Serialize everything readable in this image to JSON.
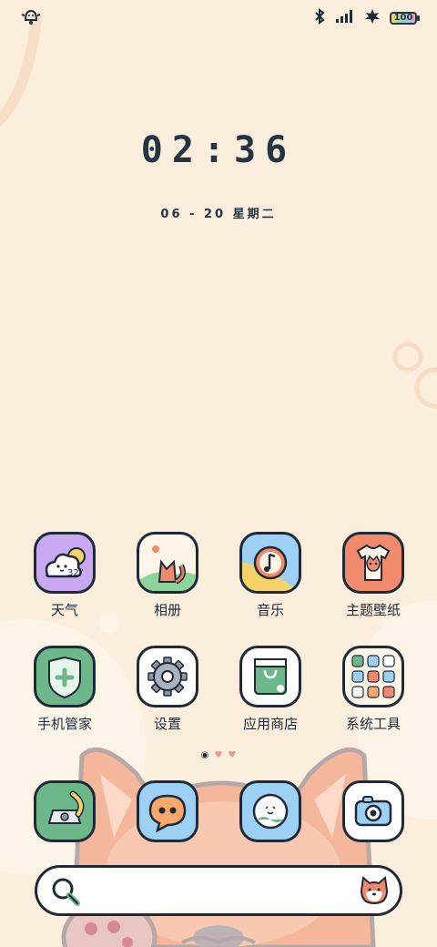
{
  "status_bar": {
    "left_icon": "notification-bell-icon",
    "right_icons": [
      "bluetooth-icon",
      "signal-icon",
      "maple-leaf-icon"
    ],
    "battery_level": "100"
  },
  "lockscreen": {
    "time": "02:36",
    "date": "06 - 20 星期二"
  },
  "apps": [
    {
      "label": "天气",
      "icon": "weather-icon",
      "temp": "32°"
    },
    {
      "label": "相册",
      "icon": "gallery-icon"
    },
    {
      "label": "音乐",
      "icon": "music-icon"
    },
    {
      "label": "主题壁纸",
      "icon": "theme-icon"
    },
    {
      "label": "手机管家",
      "icon": "phone-manager-icon"
    },
    {
      "label": "设置",
      "icon": "settings-icon"
    },
    {
      "label": "应用商店",
      "icon": "app-store-icon"
    },
    {
      "label": "系统工具",
      "icon": "system-tools-icon"
    }
  ],
  "page_indicator": {
    "count": 3,
    "current": 1
  },
  "dock": [
    {
      "icon": "phone-icon"
    },
    {
      "icon": "messages-icon"
    },
    {
      "icon": "browser-icon"
    },
    {
      "icon": "camera-icon"
    }
  ],
  "search": {
    "left_icon": "search-icon",
    "right_icon": "shiba-mascot-icon"
  },
  "colors": {
    "background": "#fbeedc",
    "outline": "#1f2a36",
    "accent_orange": "#f08a6c",
    "accent_green": "#6cb88a",
    "accent_blue": "#8ec9ef",
    "accent_purple": "#c7a7f0"
  }
}
